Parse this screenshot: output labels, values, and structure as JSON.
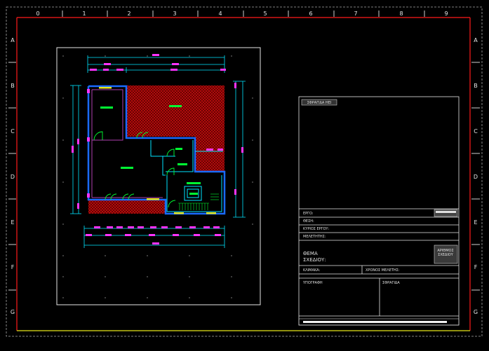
{
  "ruler": {
    "columns": [
      "0",
      "1",
      "2",
      "3",
      "4",
      "5",
      "6",
      "7",
      "8",
      "9"
    ],
    "rows": [
      "A",
      "B",
      "C",
      "D",
      "E",
      "F",
      "G"
    ]
  },
  "colors": {
    "frame": "#ff1a1a",
    "wall": "#1a6bff",
    "dimension": "#00e5ff",
    "hatch": "#c00000",
    "marker": "#ff33ff",
    "room_tag": "#00ff33"
  },
  "title_block": {
    "stamp_label": "ΣΦΡΑΓΙΔΑ ΗΕΙ",
    "ergo": "ΕΡΓΟ:",
    "thesi": "ΘΕΣΗ:",
    "kyrios": "ΚΥΡΙΟΣ ΕΡΓΟΥ:",
    "meletitis": "ΜΕΛΕΤΗΤΗΣ:",
    "thema_line1": "ΘΕΜΑ",
    "thema_line2": "ΣΧΕΔΙΟΥ:",
    "arithmos_line1": "ΑΡΙΘΜΟΣ",
    "arithmos_line2": "ΣΧΕΔΙΟΥ",
    "klimaka": "ΚΛΙΜΑΚΑ:",
    "xronos": "ΧΡΟΝΟΣ ΜΕΛΕΤΗΣ:",
    "ypografi": "ΥΠΟΓΡΑΦΗ",
    "sfragida": "ΣΦΡΑΓΙΔΑ"
  }
}
